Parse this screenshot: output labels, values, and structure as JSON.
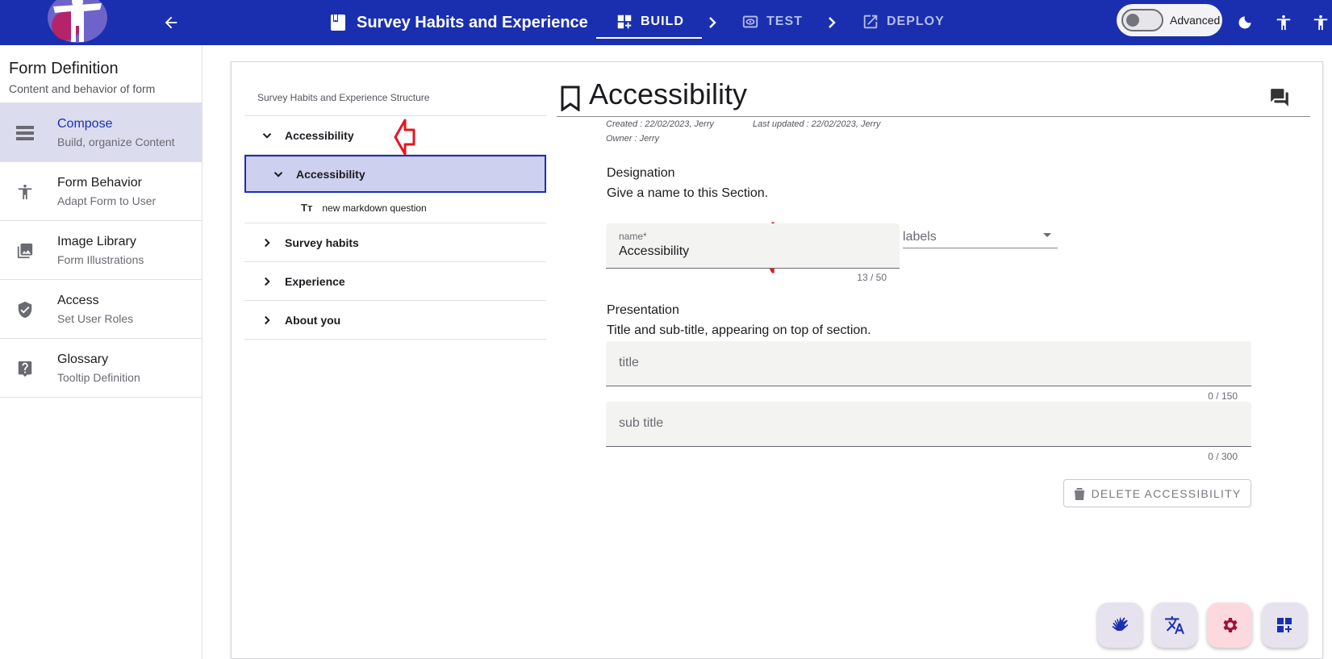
{
  "topbar": {
    "form_title": "Survey Habits and Experience",
    "steps": [
      {
        "label": "BUILD",
        "active": true
      },
      {
        "label": "TEST",
        "active": false
      },
      {
        "label": "DEPLOY",
        "active": false
      }
    ],
    "advanced_label": "Advanced",
    "colors": {
      "bar": "#1a2fb0"
    }
  },
  "leftnav": {
    "title": "Form Definition",
    "subtitle": "Content and behavior of form",
    "items": [
      {
        "label": "Compose",
        "sub": "Build, organize Content",
        "icon": "compose-icon",
        "active": true
      },
      {
        "label": "Form Behavior",
        "sub": "Adapt Form to User",
        "icon": "accessibility-icon",
        "active": false
      },
      {
        "label": "Image Library",
        "sub": "Form Illustrations",
        "icon": "image-library-icon",
        "active": false
      },
      {
        "label": "Access",
        "sub": "Set User Roles",
        "icon": "shield-check-icon",
        "active": false
      },
      {
        "label": "Glossary",
        "sub": "Tooltip Definition",
        "icon": "help-icon",
        "active": false
      }
    ]
  },
  "tree": {
    "header": "Survey Habits and Experience Structure",
    "rows": [
      {
        "label": "Accessibility",
        "kind": "section-expanded"
      },
      {
        "label": "Accessibility",
        "kind": "subsection-selected"
      },
      {
        "label": "new markdown question",
        "kind": "leaf",
        "leaf_icon": "Tт"
      },
      {
        "label": "Survey habits",
        "kind": "section-collapsed"
      },
      {
        "label": "Experience",
        "kind": "section-collapsed"
      },
      {
        "label": "About you",
        "kind": "section-collapsed"
      }
    ]
  },
  "detail": {
    "title": "Accessibility",
    "created": "Created : 22/02/2023, Jerry",
    "updated": "Last updated : 22/02/2023, Jerry",
    "owner": "Owner : Jerry",
    "designation": {
      "label": "Designation",
      "desc": "Give a name to this Section.",
      "name_label": "name*",
      "name_value": "Accessibility",
      "name_counter": "13 / 50",
      "labels_placeholder": "labels"
    },
    "presentation": {
      "label": "Presentation",
      "desc": "Title and sub-title, appearing on top of section.",
      "title_placeholder": "title",
      "title_counter": "0 / 150",
      "subtitle_placeholder": "sub title",
      "subtitle_counter": "0 / 300"
    },
    "delete_label": "DELETE ACCESSIBILITY"
  },
  "fabs": [
    {
      "icon": "sign-language-icon"
    },
    {
      "icon": "translate-icon"
    },
    {
      "icon": "settings-icon"
    },
    {
      "icon": "add-widget-icon"
    }
  ]
}
